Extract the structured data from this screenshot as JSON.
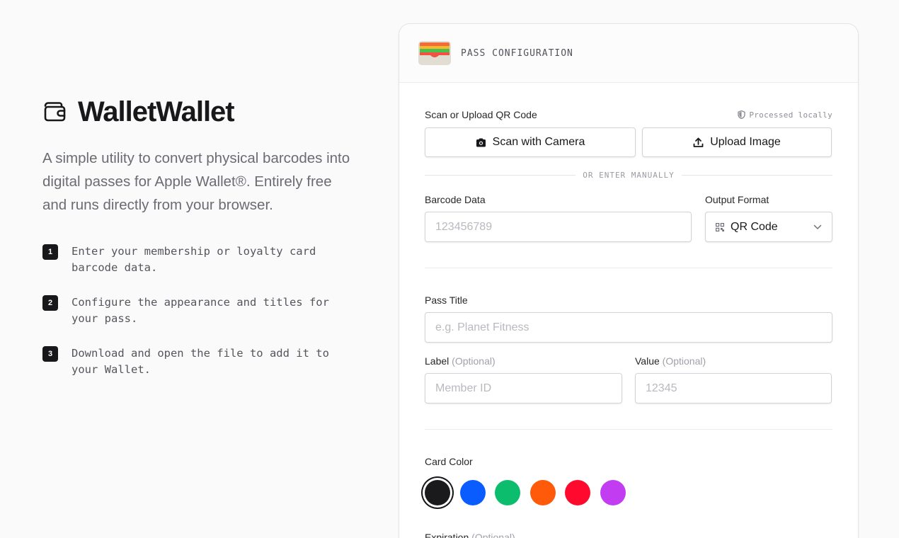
{
  "brand": {
    "name": "WalletWallet",
    "tagline": "A simple utility to convert physical barcodes into digital passes for Apple Wallet®. Entirely free and runs directly from your browser."
  },
  "steps": [
    {
      "number": "1",
      "text": "Enter your membership or loyalty card barcode data."
    },
    {
      "number": "2",
      "text": "Configure the appearance and titles for your pass."
    },
    {
      "number": "3",
      "text": "Download and open the file to add it to your Wallet."
    }
  ],
  "card": {
    "header_title": "PASS CONFIGURATION",
    "scan": {
      "label": "Scan or Upload QR Code",
      "processed_note": "Processed locally",
      "camera_button": "Scan with Camera",
      "upload_button": "Upload Image",
      "divider": "OR ENTER MANUALLY"
    },
    "barcode": {
      "label": "Barcode Data",
      "placeholder": "123456789",
      "format_label": "Output Format",
      "format_value": "QR Code"
    },
    "pass_title": {
      "label": "Pass Title",
      "placeholder": "e.g. Planet Fitness"
    },
    "label_field": {
      "label": "Label",
      "optional": "(Optional)",
      "placeholder": "Member ID"
    },
    "value_field": {
      "label": "Value",
      "optional": "(Optional)",
      "placeholder": "12345"
    },
    "card_color": {
      "label": "Card Color",
      "colors": [
        "#1a1a1c",
        "#0a5cff",
        "#0dbd6e",
        "#ff5a0a",
        "#ff0a2e",
        "#c23cf2"
      ],
      "selected": "#1a1a1c"
    },
    "expiration": {
      "label": "Expiration",
      "optional": "(Optional)"
    }
  }
}
